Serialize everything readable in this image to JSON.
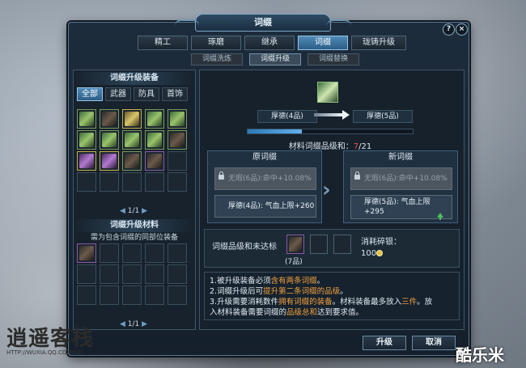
{
  "window": {
    "title": "词缀"
  },
  "corner": {
    "help": "?",
    "close": "×"
  },
  "tabs": [
    "精工",
    "琢磨",
    "继承",
    "词缀",
    "珑铸升级"
  ],
  "subtabs": [
    "词缀洗炼",
    "词缀升级",
    "词缀替换"
  ],
  "left": {
    "equip_title": "词缀升级装备",
    "categories": [
      "全部",
      "武器",
      "防具",
      "首饰"
    ],
    "equip_pager": "1/1",
    "material_title": "词缀升级材料",
    "material_hint": "需为包含词缀的同部位装备",
    "material_pager": "1/1"
  },
  "upgrade": {
    "from_name": "厚德(4品)",
    "to_name": "厚德(5品)",
    "progress_fraction": 0.33,
    "material_label": "材料词缀品级和：",
    "material_current": "7",
    "material_total": "/21"
  },
  "original": {
    "title": "原词缀",
    "locked_text": "无瑕(6品):命中+10.08%",
    "affix_text": "厚德(4品): 气血上限+260"
  },
  "new": {
    "title": "新词缀",
    "locked_text": "无瑕(6品):命中+10.08%",
    "affix_line1": "厚德(5品): 气血上限",
    "affix_line2": "+295"
  },
  "materials_row": {
    "label": "词缀品级和未达标",
    "slot1_caption": "(7品)",
    "cost_label": "消耗碎银：",
    "cost_value": "100"
  },
  "notes": {
    "l1a": "1.被升级装备必须",
    "l1b": "含有两条词缀",
    "l1c": "。",
    "l2a": "2.词缀升级后可",
    "l2b": "提升第二条词缀的品级",
    "l2c": "。",
    "l3a": "3.升级需要消耗数件",
    "l3b": "拥有词缀的装备",
    "l3c": "。材料装备最多放入",
    "l3d": "三件",
    "l3e": "。放",
    "l4a": "入材料装备需要词缀的",
    "l4b": "品级总和",
    "l4c": "达到要求值。"
  },
  "buttons": {
    "upgrade": "升级",
    "cancel": "取消"
  },
  "watermark_left": {
    "title": "逍遥客栈",
    "url": "HTTP://WUXIA.QQ.COM/KZ/"
  },
  "watermark_right": "酷乐米",
  "colors": {
    "accent": "#4f8ab7",
    "warn": "#e0503e",
    "orange": "#f0a040"
  }
}
